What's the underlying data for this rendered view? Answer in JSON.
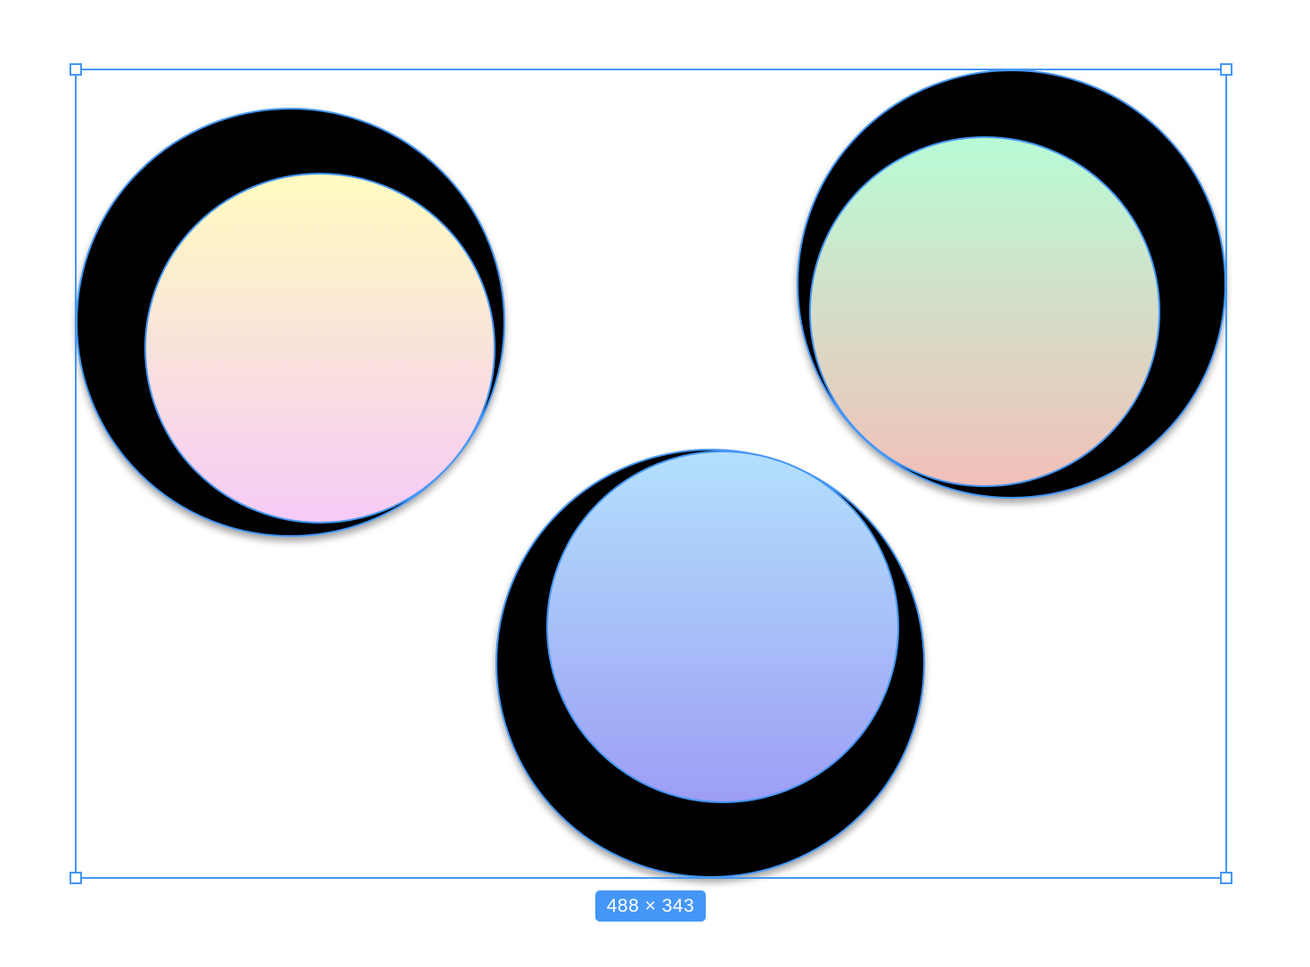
{
  "selection": {
    "size_label": "488 × 343",
    "accent_color": "#4597f7"
  },
  "shapes": [
    {
      "name": "yellow-pink",
      "gradient_top": "#fffbbf",
      "gradient_bottom": "#f5cbf7"
    },
    {
      "name": "green-peach",
      "gradient_top": "#b8fbd6",
      "gradient_bottom": "#f2c0b8"
    },
    {
      "name": "blue-violet",
      "gradient_top": "#b3e0fc",
      "gradient_bottom": "#9d9ef5"
    }
  ]
}
